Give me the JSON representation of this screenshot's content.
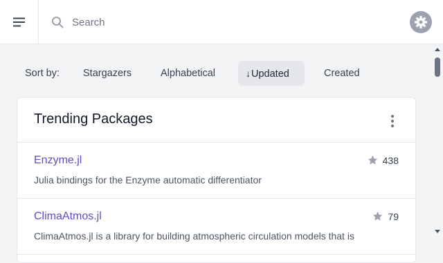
{
  "header": {
    "menu_icon": "hamburger-menu-icon",
    "search_icon": "search-icon",
    "search_placeholder": "Search",
    "search_value": "",
    "settings_icon": "gear-icon"
  },
  "sort": {
    "label": "Sort by:",
    "options": [
      {
        "label": "Stargazers",
        "active": false
      },
      {
        "label": "Alphabetical",
        "active": false
      },
      {
        "label": "Updated",
        "active": true,
        "icon": "arrow-down-icon"
      },
      {
        "label": "Created",
        "active": false
      }
    ]
  },
  "card": {
    "title": "Trending Packages",
    "packages": [
      {
        "name": "Enzyme.jl",
        "description": "Julia bindings for the Enzyme automatic differentiator",
        "stars": "438"
      },
      {
        "name": "ClimaAtmos.jl",
        "description": "ClimaAtmos.jl is a library for building atmospheric circulation models that is",
        "stars": "79"
      }
    ]
  },
  "colors": {
    "accent_link": "#5b4fc7",
    "background": "#f3f4f6",
    "active_sort": "#e5e7eb"
  }
}
